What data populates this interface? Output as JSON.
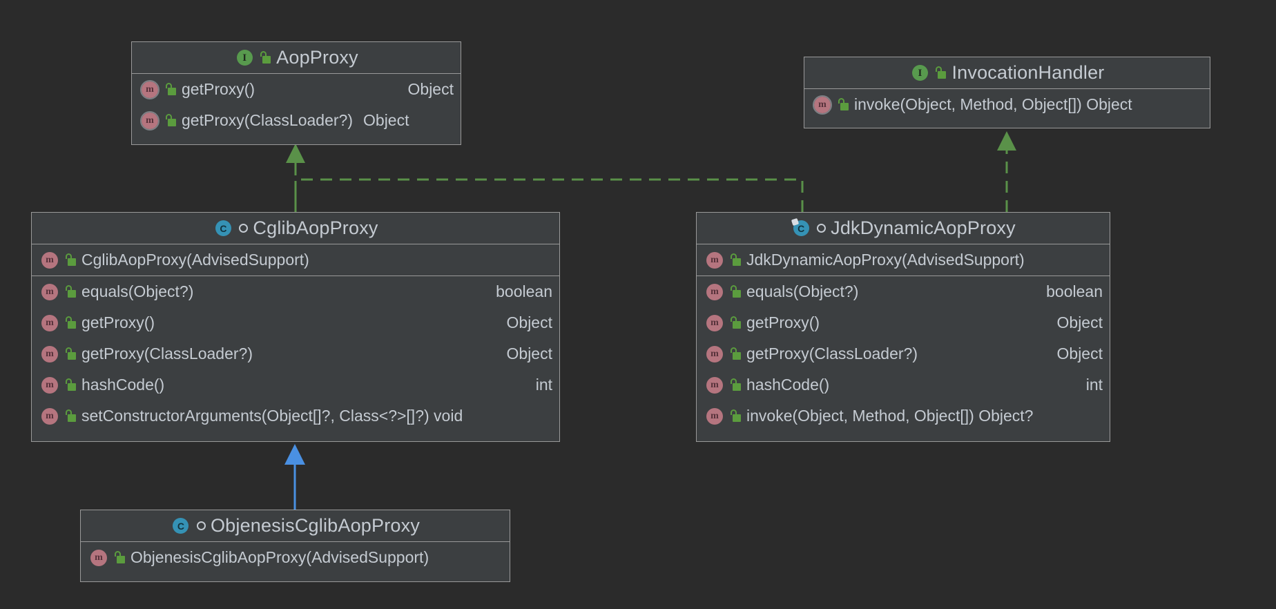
{
  "theme": {
    "background": "#2b2b2b",
    "box_fill": "#3c3f41",
    "box_border": "#9a9a9a",
    "text": "#c5cbd2",
    "interface_icon": "#589a4e",
    "class_icon": "#3592b5",
    "member_icon": "#b5757f",
    "visibility_public": "#5b9c3e",
    "realization_edge": "#5a9149",
    "inheritance_edge": "#4a90e2"
  },
  "diagram": {
    "type": "uml-class-diagram",
    "classes": [
      {
        "id": "AopProxy",
        "name": "AopProxy",
        "stereotype": "interface",
        "kind_icon": "interface-icon",
        "kind_letter": "I",
        "visibility_icon": "public-unlocked-icon",
        "is_final": false,
        "members": [
          {
            "name": "getProxy()",
            "return_type": "Object",
            "icon": "abstract-method-icon",
            "abstract": true,
            "visibility": "public",
            "separator_after": false
          },
          {
            "name": "getProxy(ClassLoader?)",
            "return_type": "Object",
            "icon": "abstract-method-icon",
            "abstract": true,
            "visibility": "public",
            "separator_after": false
          }
        ]
      },
      {
        "id": "InvocationHandler",
        "name": "InvocationHandler",
        "stereotype": "interface",
        "kind_icon": "interface-icon",
        "kind_letter": "I",
        "visibility_icon": "public-unlocked-icon",
        "is_final": false,
        "members": [
          {
            "name": "invoke(Object, Method, Object[]) Object",
            "return_type": "",
            "icon": "abstract-method-icon",
            "abstract": true,
            "visibility": "public",
            "separator_after": false
          }
        ]
      },
      {
        "id": "CglibAopProxy",
        "name": "CglibAopProxy",
        "stereotype": "class",
        "kind_icon": "class-icon",
        "kind_letter": "C",
        "visibility_icon": "package-private-ring-icon",
        "is_final": false,
        "members": [
          {
            "name": "CglibAopProxy(AdvisedSupport)",
            "return_type": "",
            "icon": "method-icon",
            "abstract": false,
            "visibility": "public",
            "separator_after": true
          },
          {
            "name": "equals(Object?)",
            "return_type": "boolean",
            "icon": "method-icon",
            "abstract": false,
            "visibility": "public",
            "separator_after": false
          },
          {
            "name": "getProxy()",
            "return_type": "Object",
            "icon": "method-icon",
            "abstract": false,
            "visibility": "public",
            "separator_after": false
          },
          {
            "name": "getProxy(ClassLoader?)",
            "return_type": "Object",
            "icon": "method-icon",
            "abstract": false,
            "visibility": "public",
            "separator_after": false
          },
          {
            "name": "hashCode()",
            "return_type": "int",
            "icon": "method-icon",
            "abstract": false,
            "visibility": "public",
            "separator_after": false
          },
          {
            "name": "setConstructorArguments(Object[]?, Class<?>[]?) void",
            "return_type": "",
            "icon": "method-icon",
            "abstract": false,
            "visibility": "public",
            "separator_after": false
          }
        ]
      },
      {
        "id": "JdkDynamicAopProxy",
        "name": "JdkDynamicAopProxy",
        "stereotype": "class",
        "kind_icon": "class-icon",
        "kind_letter": "C",
        "visibility_icon": "package-private-ring-icon",
        "is_final": true,
        "members": [
          {
            "name": "JdkDynamicAopProxy(AdvisedSupport)",
            "return_type": "",
            "icon": "method-icon",
            "abstract": false,
            "visibility": "public",
            "separator_after": true
          },
          {
            "name": "equals(Object?)",
            "return_type": "boolean",
            "icon": "method-icon",
            "abstract": false,
            "visibility": "public",
            "separator_after": false
          },
          {
            "name": "getProxy()",
            "return_type": "Object",
            "icon": "method-icon",
            "abstract": false,
            "visibility": "public",
            "separator_after": false
          },
          {
            "name": "getProxy(ClassLoader?)",
            "return_type": "Object",
            "icon": "method-icon",
            "abstract": false,
            "visibility": "public",
            "separator_after": false
          },
          {
            "name": "hashCode()",
            "return_type": "int",
            "icon": "method-icon",
            "abstract": false,
            "visibility": "public",
            "separator_after": false
          },
          {
            "name": "invoke(Object, Method, Object[]) Object?",
            "return_type": "",
            "icon": "method-icon",
            "abstract": false,
            "visibility": "public",
            "separator_after": false
          }
        ]
      },
      {
        "id": "ObjenesisCglibAopProxy",
        "name": "ObjenesisCglibAopProxy",
        "stereotype": "class",
        "kind_icon": "class-icon",
        "kind_letter": "C",
        "visibility_icon": "package-private-ring-icon",
        "is_final": false,
        "members": [
          {
            "name": "ObjenesisCglibAopProxy(AdvisedSupport)",
            "return_type": "",
            "icon": "method-icon",
            "abstract": false,
            "visibility": "public",
            "separator_after": false
          }
        ]
      }
    ],
    "relations": [
      {
        "from": "CglibAopProxy",
        "to": "AopProxy",
        "type": "realization",
        "style": "dashed",
        "arrow": "hollow-triangle",
        "color": "#5a9149"
      },
      {
        "from": "JdkDynamicAopProxy",
        "to": "AopProxy",
        "type": "realization",
        "style": "dashed",
        "arrow": "hollow-triangle",
        "color": "#5a9149"
      },
      {
        "from": "JdkDynamicAopProxy",
        "to": "InvocationHandler",
        "type": "realization",
        "style": "dashed",
        "arrow": "hollow-triangle",
        "color": "#5a9149"
      },
      {
        "from": "ObjenesisCglibAopProxy",
        "to": "CglibAopProxy",
        "type": "inheritance",
        "style": "solid",
        "arrow": "hollow-triangle",
        "color": "#4a90e2"
      }
    ]
  }
}
